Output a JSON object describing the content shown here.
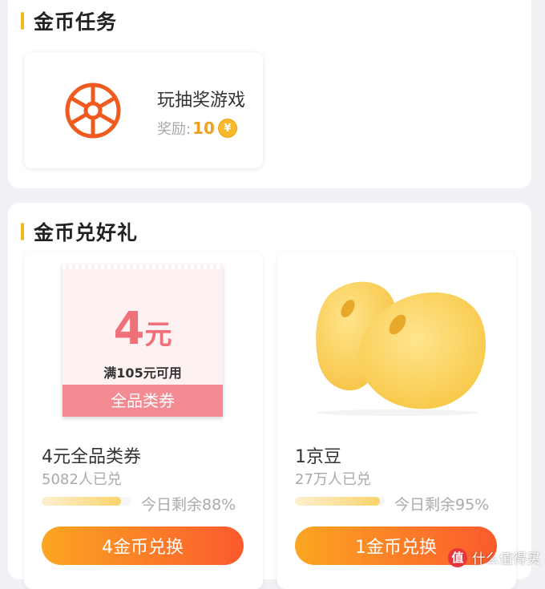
{
  "tasks": {
    "title": "金币任务",
    "items": [
      {
        "name": "玩抽奖游戏",
        "reward_label": "奖励:",
        "reward_amount": "10",
        "coin_symbol": "¥",
        "icon": "wheel-icon"
      }
    ]
  },
  "gifts": {
    "title": "金币兑好礼",
    "items": [
      {
        "image_amount": "4",
        "image_unit": "元",
        "image_condition": "满105元可用",
        "image_footer": "全品类券",
        "title": "4元全品类券",
        "exchanged": "5082人已兑",
        "progress_fraction": 0.88,
        "remaining": "今日剩余88%",
        "button": "4金币兑换"
      },
      {
        "image": "beans-icon",
        "title": "1京豆",
        "exchanged": "27万人已兑",
        "progress_fraction": 0.95,
        "remaining": "今日剩余95%",
        "button": "1金币兑换"
      }
    ]
  },
  "watermark": {
    "badge": "值",
    "text": "什么值得买"
  },
  "colors": {
    "accent": "#f5b825",
    "button_start": "#fba621",
    "button_end": "#fb5a2d",
    "wheel": "#f05a1e"
  }
}
